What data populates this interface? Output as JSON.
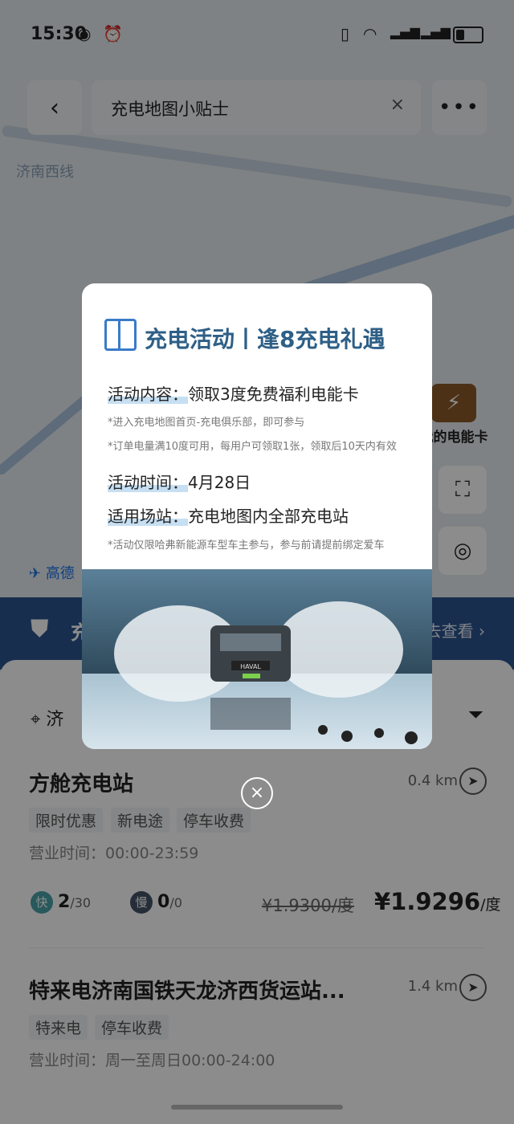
{
  "status_bar": {
    "time": "15:30"
  },
  "header": {
    "title": "充电地图小贴士",
    "clear_symbol": "×",
    "back_symbol": "‹",
    "more_symbol": "•••"
  },
  "map": {
    "road_label": "济南西线",
    "my_card_label": "我的电能卡",
    "gaode_label": "高德"
  },
  "banner": {
    "text": "充",
    "more": "去查看 ›"
  },
  "location": {
    "text": "济"
  },
  "stations": [
    {
      "name": "方舱充电站",
      "distance": "0.4 km",
      "tags": [
        "限时优惠",
        "新电途",
        "停车收费"
      ],
      "hours": "营业时间：00:00-23:59",
      "fast": {
        "badge": "快",
        "available": "2",
        "total": "/30"
      },
      "slow": {
        "badge": "慢",
        "available": "0",
        "total": "/0"
      },
      "old_price": "¥1.9300/度",
      "new_price": "¥1.9296",
      "unit": "/度"
    },
    {
      "name": "特来电济南国铁天龙济西货运站...",
      "distance": "1.4 km",
      "tags": [
        "特来电",
        "停车收费"
      ],
      "hours": "营业时间：周一至周日00:00-24:00"
    }
  ],
  "modal": {
    "title": "充电活动丨逢8充电礼遇",
    "content_label": "活动内容：",
    "content_value": "领取3度免费福利电能卡",
    "note1": "*进入充电地图首页-充电俱乐部，即可参与",
    "note2": "*订单电量满10度可用，每用户可领取1张，领取后10天内有效",
    "time_label": "活动时间：",
    "time_value": "4月28日",
    "station_label": "适用场站：",
    "station_value": "充电地图内全部充电站",
    "note3": "*活动仅限哈弗新能源车型车主参与，参与前请提前绑定爱车",
    "car_badge": "HAVAL"
  },
  "close_symbol": "×",
  "colors": {
    "modal_title": "#2e5f86",
    "banner": "#2c5590",
    "underline": "#c6dff2"
  }
}
